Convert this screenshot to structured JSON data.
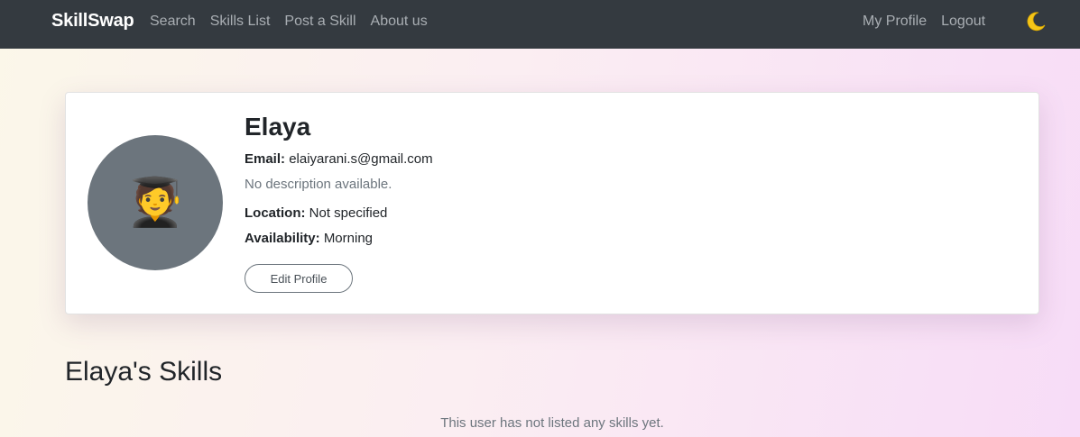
{
  "navbar": {
    "brand": "SkillSwap",
    "left_links": [
      "Search",
      "Skills List",
      "Post a Skill",
      "About us"
    ],
    "right_links": [
      "My Profile",
      "Logout"
    ],
    "theme_toggle_icon": "moon-icon"
  },
  "profile": {
    "name": "Elaya",
    "email_label": "Email:",
    "email": "elaiyarani.s@gmail.com",
    "description": "No description available.",
    "location_label": "Location:",
    "location": "Not specified",
    "availability_label": "Availability:",
    "availability": "Morning",
    "edit_button": "Edit Profile",
    "avatar_emoji": "🧑‍🎓"
  },
  "skills": {
    "heading": "Elaya's Skills",
    "empty_message": "This user has not listed any skills yet."
  },
  "colors": {
    "navbar_bg": "#343a40",
    "avatar_bg": "#6c757d",
    "moon": "#f5c518"
  }
}
